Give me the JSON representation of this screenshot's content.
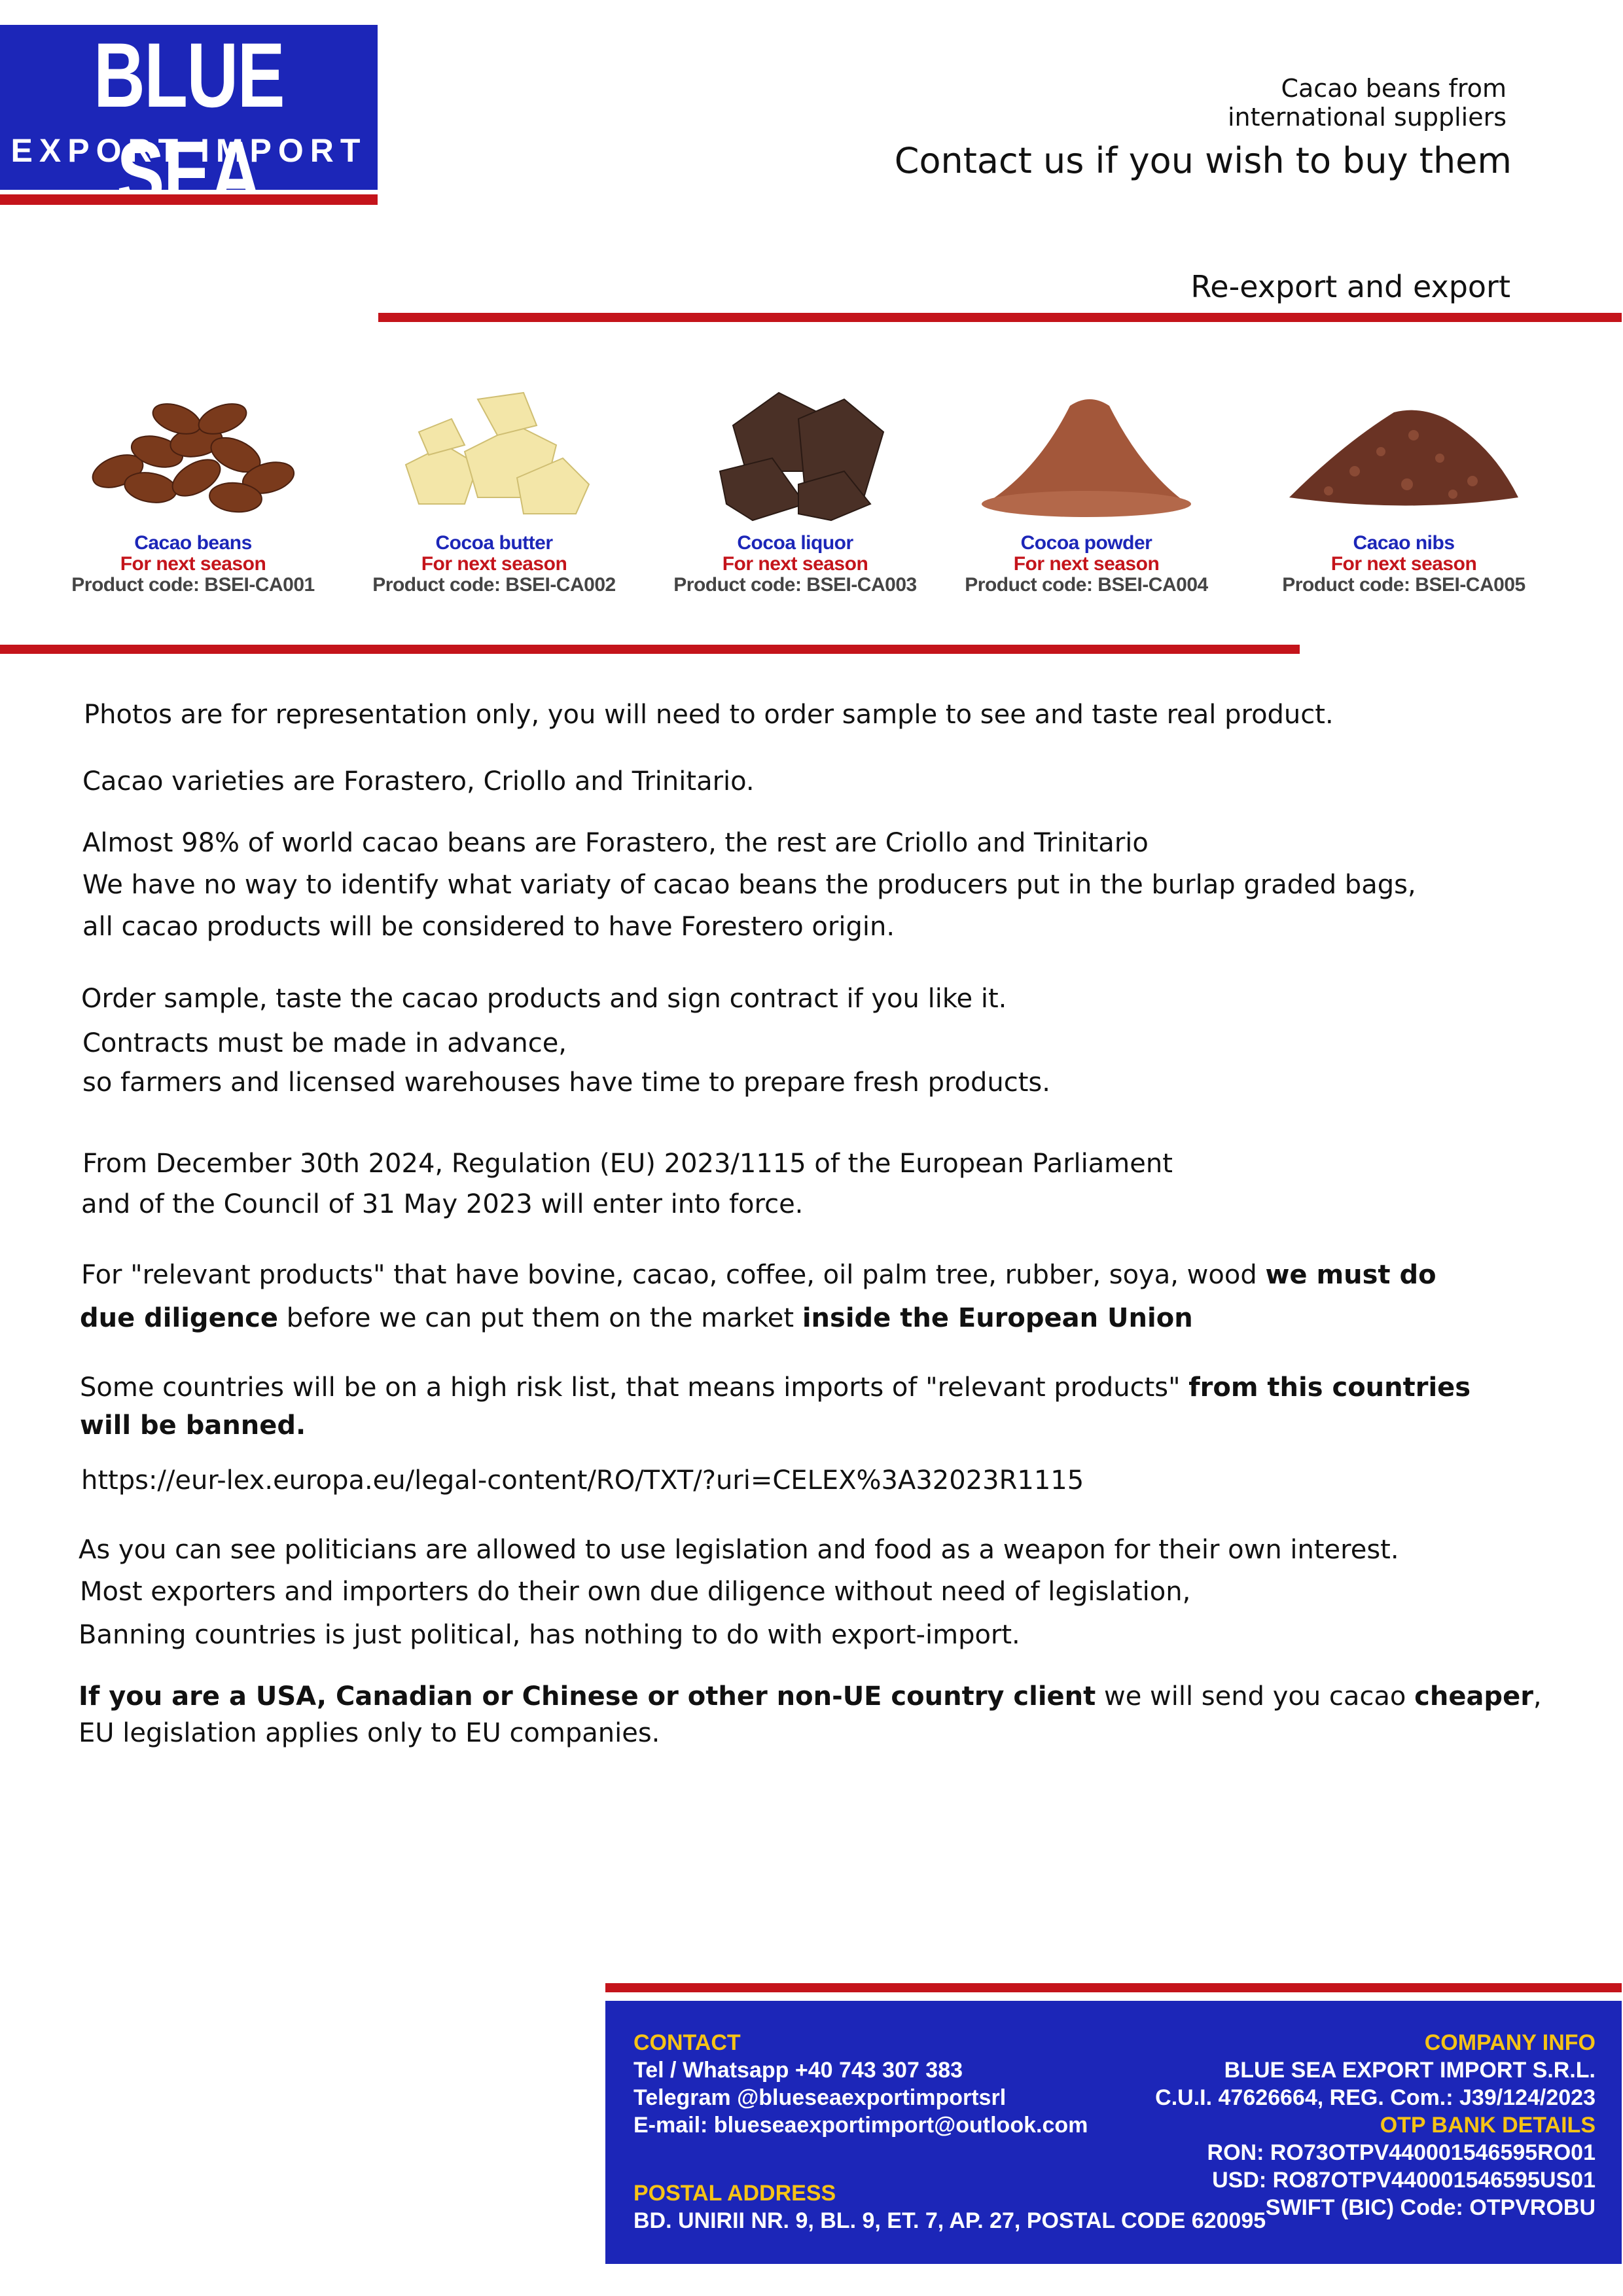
{
  "logo": {
    "line1": "BLUE SEA",
    "line2": "EXPORT IMPORT"
  },
  "header": {
    "sub1": "Cacao beans from",
    "sub2": "international suppliers",
    "main": "Contact us if you wish to buy them",
    "section": "Re-export and export"
  },
  "products": [
    {
      "name": "Cacao beans",
      "season": "For next season",
      "code": "Product code: BSEI-CA001"
    },
    {
      "name": "Cocoa butter",
      "season": "For next season",
      "code": "Product code: BSEI-CA002"
    },
    {
      "name": "Cocoa liquor",
      "season": "For next season",
      "code": "Product code: BSEI-CA003"
    },
    {
      "name": "Cocoa powder",
      "season": "For next season",
      "code": "Product code: BSEI-CA004"
    },
    {
      "name": "Cacao nibs",
      "season": "For next season",
      "code": "Product code: BSEI-CA005"
    }
  ],
  "body": {
    "p1": "Photos are for representation only, you will need to order sample to see and taste real product.",
    "p2": "Cacao varieties are Forastero, Criollo and Trinitario.",
    "p3a": "Almost 98% of world cacao beans are Forastero, the rest are Criollo and Trinitario",
    "p3b": "We have no way to identify what variaty of cacao beans the producers put in the burlap graded bags,",
    "p3c": "all cacao products will be considered to have Forestero origin.",
    "p4a": "Order sample, taste the cacao products and sign contract if you like it.",
    "p4b": "Contracts must be made in advance,",
    "p4c": "so farmers and licensed warehouses have time to prepare fresh products.",
    "p5a": "From December 30th 2024, Regulation (EU) 2023/1115 of the European Parliament",
    "p5b": "and of the Council of 31 May 2023 will enter into force.",
    "p6a_pre": "For \"relevant products\" that have bovine, cacao, coffee, oil palm tree, rubber, soya, wood ",
    "p6a_bold": "we must do",
    "p6b_bold1": "due diligence",
    "p6b_mid": " before we can put them on the market ",
    "p6b_bold2": "inside the European Union",
    "p7a_pre": "Some countries will be on a high risk list, that means imports of \"relevant products\" ",
    "p7a_bold": "from this countries",
    "p7b_bold": "will be banned.",
    "link": "https://eur-lex.europa.eu/legal-content/RO/TXT/?uri=CELEX%3A32023R1115",
    "p8a": "As you can see  politicians are allowed to use legislation and food as a weapon for their own interest.",
    "p8b": "Most exporters and importers do their own due diligence without need of legislation,",
    "p8c": "Banning countries is just political, has nothing to do with export-import.",
    "p9a_bold": "If you are a USA, Canadian or Chinese or other non-UE country client",
    "p9a_mid": " we will send you cacao ",
    "p9a_bold2": "cheaper",
    "p9a_end": ",",
    "p9b": "EU legislation applies only to EU companies."
  },
  "footer": {
    "contact_head": "CONTACT",
    "tel": "Tel / Whatsapp +40 743 307 383",
    "telegram": "Telegram @blueseaexportimportsrl",
    "email": "E-mail: blueseaexportimport@outlook.com",
    "postal_head": "POSTAL ADDRESS",
    "postal": "BD. UNIRII NR. 9, BL. 9, ET. 7, AP. 27, POSTAL CODE 620095",
    "company_head": "COMPANY INFO",
    "company": "BLUE SEA EXPORT IMPORT S.R.L.",
    "cui": "C.U.I. 47626664, REG. Com.: J39/124/2023",
    "bank_head": "OTP BANK DETAILS",
    "ron": "RON: RO73OTPV440001546595RO01",
    "usd": "USD: RO87OTPV440001546595US01",
    "swift": "SWIFT (BIC) Code: OTPVROBU"
  },
  "colors": {
    "brand_blue": "#1c26b8",
    "accent_red": "#c4141b",
    "footer_heading": "#f6c316"
  }
}
